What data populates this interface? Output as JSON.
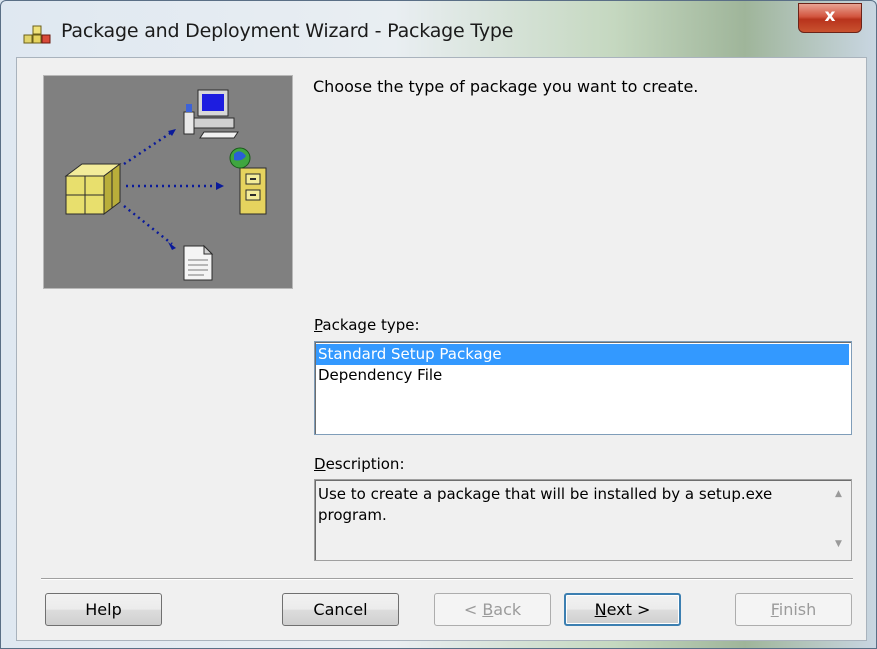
{
  "window": {
    "title": "Package and Deployment Wizard - Package Type",
    "close_label": "x"
  },
  "main": {
    "heading": "Choose the type of package you want to create.",
    "package_type_label_prefix": "",
    "package_type_label_accel": "P",
    "package_type_label_rest": "ackage type:",
    "package_types": [
      {
        "label": "Standard Setup Package",
        "selected": true
      },
      {
        "label": "Dependency File",
        "selected": false
      }
    ],
    "description_label_accel": "D",
    "description_label_rest": "escription:",
    "description_text": "Use to create a package that will be installed by a setup.exe program."
  },
  "buttons": {
    "help": "Help",
    "cancel": "Cancel",
    "back_accel": "B",
    "back_prefix": "< ",
    "back_rest": "ack",
    "next_accel": "N",
    "next_rest": "ext >",
    "finish_accel": "F",
    "finish_rest": "inish"
  },
  "icons": {
    "app": "package-wizard-icon",
    "art": "package-to-destinations-illustration"
  },
  "colors": {
    "selection": "#3399ff",
    "art_background": "#808080",
    "close_button": "#c8452d"
  }
}
